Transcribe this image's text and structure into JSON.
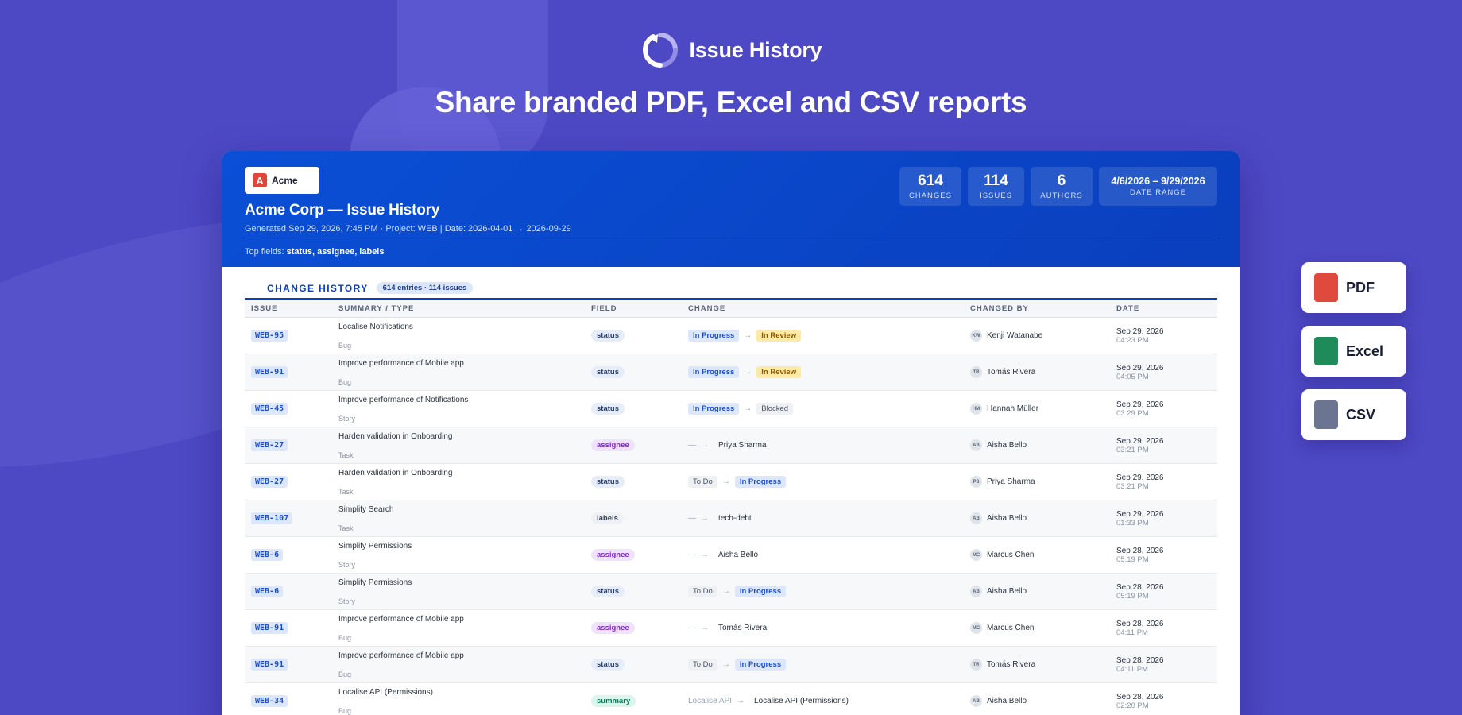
{
  "hero": {
    "app_name": "Issue History",
    "tagline": "Share branded PDF, Excel and CSV reports"
  },
  "report": {
    "brand_name": "Acme",
    "title": "Acme Corp — Issue History",
    "meta": "Generated Sep 29, 2026, 7:45 PM  ·  Project: WEB | Date: 2026-04-01 → 2026-09-29",
    "top_fields_label": "Top fields:",
    "top_fields_value": "status, assignee, labels",
    "stats": [
      {
        "value": "614",
        "label": "CHANGES"
      },
      {
        "value": "114",
        "label": "ISSUES"
      },
      {
        "value": "6",
        "label": "AUTHORS"
      },
      {
        "value": "4/6/2026 – 9/29/2026",
        "label": "DATE RANGE"
      }
    ],
    "section_title": "CHANGE HISTORY",
    "section_badge": "614 entries · 114 issues",
    "columns": [
      "ISSUE",
      "SUMMARY / TYPE",
      "FIELD",
      "CHANGE",
      "CHANGED BY",
      "DATE"
    ],
    "rows": [
      {
        "key": "WEB-95",
        "summary": "Localise Notifications",
        "type": "Bug",
        "field": "status",
        "from": "In Progress",
        "to": "In Review",
        "initials": "KW",
        "author": "Kenji Watanabe",
        "date": "Sep 29, 2026",
        "time": "04:23 PM"
      },
      {
        "key": "WEB-91",
        "summary": "Improve performance of Mobile app",
        "type": "Bug",
        "field": "status",
        "from": "In Progress",
        "to": "In Review",
        "initials": "TR",
        "author": "Tomás Rivera",
        "date": "Sep 29, 2026",
        "time": "04:05 PM"
      },
      {
        "key": "WEB-45",
        "summary": "Improve performance of Notifications",
        "type": "Story",
        "field": "status",
        "from": "In Progress",
        "to": "Blocked",
        "initials": "HM",
        "author": "Hannah Müller",
        "date": "Sep 29, 2026",
        "time": "03:29 PM"
      },
      {
        "key": "WEB-27",
        "summary": "Harden validation in Onboarding",
        "type": "Task",
        "field": "assignee",
        "from": "—",
        "to": "Priya Sharma",
        "initials": "AB",
        "author": "Aisha Bello",
        "date": "Sep 29, 2026",
        "time": "03:21 PM"
      },
      {
        "key": "WEB-27",
        "summary": "Harden validation in Onboarding",
        "type": "Task",
        "field": "status",
        "from": "To Do",
        "to": "In Progress",
        "initials": "PS",
        "author": "Priya Sharma",
        "date": "Sep 29, 2026",
        "time": "03:21 PM"
      },
      {
        "key": "WEB-107",
        "summary": "Simplify Search",
        "type": "Task",
        "field": "labels",
        "from": "—",
        "to": "tech-debt",
        "initials": "AB",
        "author": "Aisha Bello",
        "date": "Sep 29, 2026",
        "time": "01:33 PM"
      },
      {
        "key": "WEB-6",
        "summary": "Simplify Permissions",
        "type": "Story",
        "field": "assignee",
        "from": "—",
        "to": "Aisha Bello",
        "initials": "MC",
        "author": "Marcus Chen",
        "date": "Sep 28, 2026",
        "time": "05:19 PM"
      },
      {
        "key": "WEB-6",
        "summary": "Simplify Permissions",
        "type": "Story",
        "field": "status",
        "from": "To Do",
        "to": "In Progress",
        "initials": "AB",
        "author": "Aisha Bello",
        "date": "Sep 28, 2026",
        "time": "05:19 PM"
      },
      {
        "key": "WEB-91",
        "summary": "Improve performance of Mobile app",
        "type": "Bug",
        "field": "assignee",
        "from": "—",
        "to": "Tomás Rivera",
        "initials": "MC",
        "author": "Marcus Chen",
        "date": "Sep 28, 2026",
        "time": "04:11 PM"
      },
      {
        "key": "WEB-91",
        "summary": "Improve performance of Mobile app",
        "type": "Bug",
        "field": "status",
        "from": "To Do",
        "to": "In Progress",
        "initials": "TR",
        "author": "Tomás Rivera",
        "date": "Sep 28, 2026",
        "time": "04:11 PM"
      },
      {
        "key": "WEB-34",
        "summary": "Localise API (Permissions)",
        "type": "Bug",
        "field": "summary",
        "from": "Localise API",
        "to": "Localise API (Permissions)",
        "initials": "AB",
        "author": "Aisha Bello",
        "date": "Sep 28, 2026",
        "time": "02:20 PM"
      }
    ]
  },
  "exports": [
    {
      "label": "PDF",
      "color": "#e04a3c"
    },
    {
      "label": "Excel",
      "color": "#1f8a5a"
    },
    {
      "label": "CSV",
      "color": "#6b7591"
    }
  ],
  "colors": {
    "background": "#4d48c4",
    "report_header": "#0a44c8",
    "accent": "#0a3fbd"
  }
}
